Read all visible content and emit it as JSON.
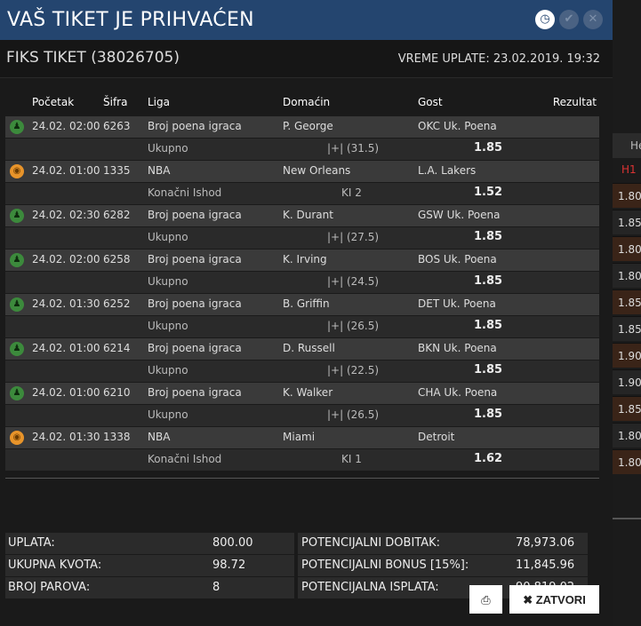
{
  "title": "VAŠ TIKET JE PRIHVAĆEN",
  "icons": {
    "clock": "◷",
    "ok": "✔",
    "close": "✕"
  },
  "ticket": {
    "label": "FIKS TIKET (38026705)",
    "time": "VREME UPLATE: 23.02.2019. 19:32"
  },
  "columns": {
    "start": "Početak",
    "code": "Šifra",
    "league": "Liga",
    "home": "Domaćin",
    "away": "Gost",
    "result": "Rezultat"
  },
  "matches": [
    {
      "sport": "players",
      "icon": "♟",
      "start": "24.02. 02:00",
      "code": "6263",
      "league": "Broj poena igraca",
      "home": "P. George",
      "away": "OKC Uk. Poena",
      "market": "Ukupno",
      "pick": "|+| (31.5)",
      "odd": "1.85"
    },
    {
      "sport": "basketball",
      "icon": "◉",
      "start": "24.02. 01:00",
      "code": "1335",
      "league": "NBA",
      "home": "New Orleans",
      "away": "L.A. Lakers",
      "market": "Konačni Ishod",
      "pick": "KI 2",
      "odd": "1.52"
    },
    {
      "sport": "players",
      "icon": "♟",
      "start": "24.02. 02:30",
      "code": "6282",
      "league": "Broj poena igraca",
      "home": "K. Durant",
      "away": "GSW Uk. Poena",
      "market": "Ukupno",
      "pick": "|+| (27.5)",
      "odd": "1.85"
    },
    {
      "sport": "players",
      "icon": "♟",
      "start": "24.02. 02:00",
      "code": "6258",
      "league": "Broj poena igraca",
      "home": "K. Irving",
      "away": "BOS Uk. Poena",
      "market": "Ukupno",
      "pick": "|+| (24.5)",
      "odd": "1.85"
    },
    {
      "sport": "players",
      "icon": "♟",
      "start": "24.02. 01:30",
      "code": "6252",
      "league": "Broj poena igraca",
      "home": "B. Griffin",
      "away": "DET Uk. Poena",
      "market": "Ukupno",
      "pick": "|+| (26.5)",
      "odd": "1.85"
    },
    {
      "sport": "players",
      "icon": "♟",
      "start": "24.02. 01:00",
      "code": "6214",
      "league": "Broj poena igraca",
      "home": "D. Russell",
      "away": "BKN Uk. Poena",
      "market": "Ukupno",
      "pick": "|+| (22.5)",
      "odd": "1.85"
    },
    {
      "sport": "players",
      "icon": "♟",
      "start": "24.02. 01:00",
      "code": "6210",
      "league": "Broj poena igraca",
      "home": "K. Walker",
      "away": "CHA Uk. Poena",
      "market": "Ukupno",
      "pick": "|+| (26.5)",
      "odd": "1.85"
    },
    {
      "sport": "basketball",
      "icon": "◉",
      "start": "24.02. 01:30",
      "code": "1338",
      "league": "NBA",
      "home": "Miami",
      "away": "Detroit",
      "market": "Konačni Ishod",
      "pick": "KI 1",
      "odd": "1.62"
    }
  ],
  "summary": {
    "stake_label": "UPLATA:",
    "stake": "800.00",
    "total_odds_label": "UKUPNA KVOTA:",
    "total_odds": "98.72",
    "pairs_label": "BROJ PAROVA:",
    "pairs": "8",
    "win_label": "POTENCIJALNI DOBITAK:",
    "win": "78,973.06",
    "bonus_label": "POTENCIJALNI BONUS [15%]:",
    "bonus": "11,845.96",
    "payout_label": "POTENCIJALNA ISPLATA:",
    "payout": "90,819.02"
  },
  "buttons": {
    "print_icon": "⎙",
    "close_icon": "✖",
    "close_label": "ZATVORI"
  },
  "background": {
    "header": "He",
    "h1": "H1",
    "odds": [
      "1.80",
      "1.85",
      "1.80",
      "1.80",
      "1.85",
      "1.85",
      "1.90",
      "1.90",
      "1.85",
      "1.80",
      "1.80"
    ]
  }
}
